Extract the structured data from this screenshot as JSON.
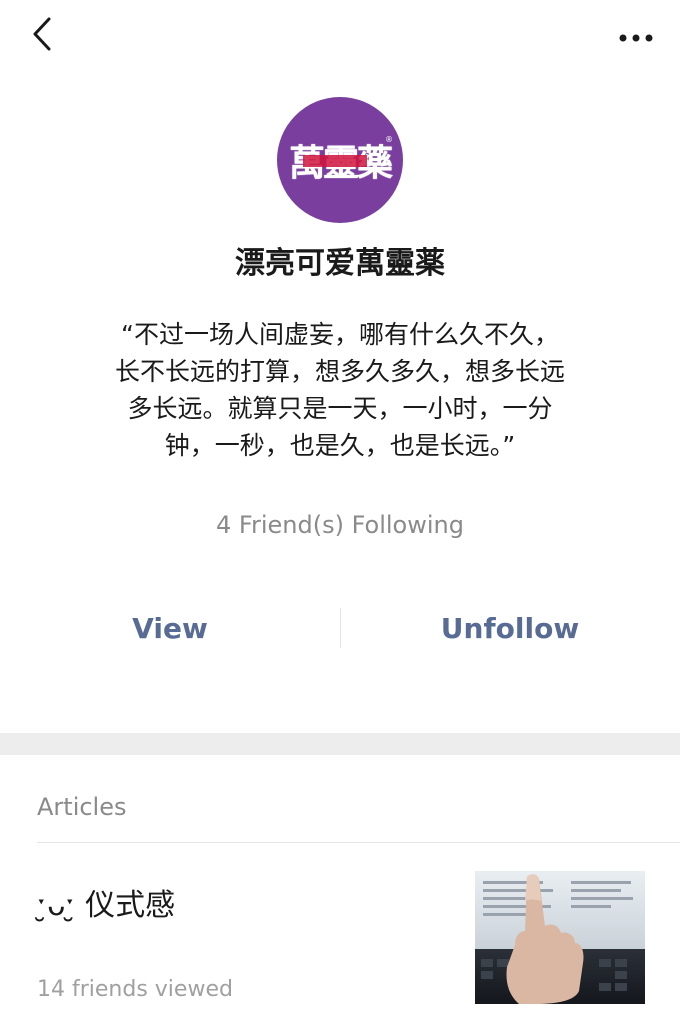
{
  "header": {
    "back_icon": "chevron-left-icon",
    "more_icon": "ellipsis-icon"
  },
  "profile": {
    "avatar_text": "萬靈藥",
    "name": "漂亮可爱萬靈薬",
    "bio_lines": [
      "“不过一场人间虚妄，哪有什么久不久，",
      "长不长远的打算，想多久多久，想多长远",
      "多长远。就算只是一天，一小时，一分",
      "钟，一秒，也是久，也是长远。”"
    ],
    "following_text": "4 Friend(s) Following",
    "avatar_color": "#7a3f9e"
  },
  "actions": {
    "view_label": "View",
    "unfollow_label": "Unfollow",
    "link_color": "#576b95"
  },
  "articles": {
    "heading": "Articles",
    "items": [
      {
        "title": "ˑ̮ᴗˑ̮ 仪式感",
        "meta": "14 friends viewed",
        "thumbnail": "hand-on-laptop-photo"
      }
    ]
  }
}
